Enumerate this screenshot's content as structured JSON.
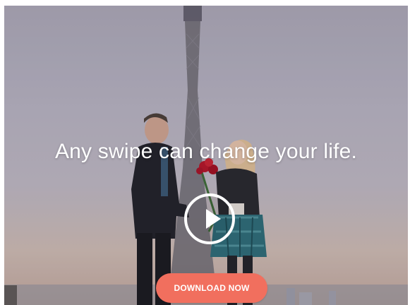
{
  "hero": {
    "headline": "Any swipe can change your life.",
    "download_label": "DOWNLOAD NOW",
    "play_icon": "play-icon"
  },
  "colors": {
    "accent": "#f16f5e",
    "text": "#ffffff"
  }
}
